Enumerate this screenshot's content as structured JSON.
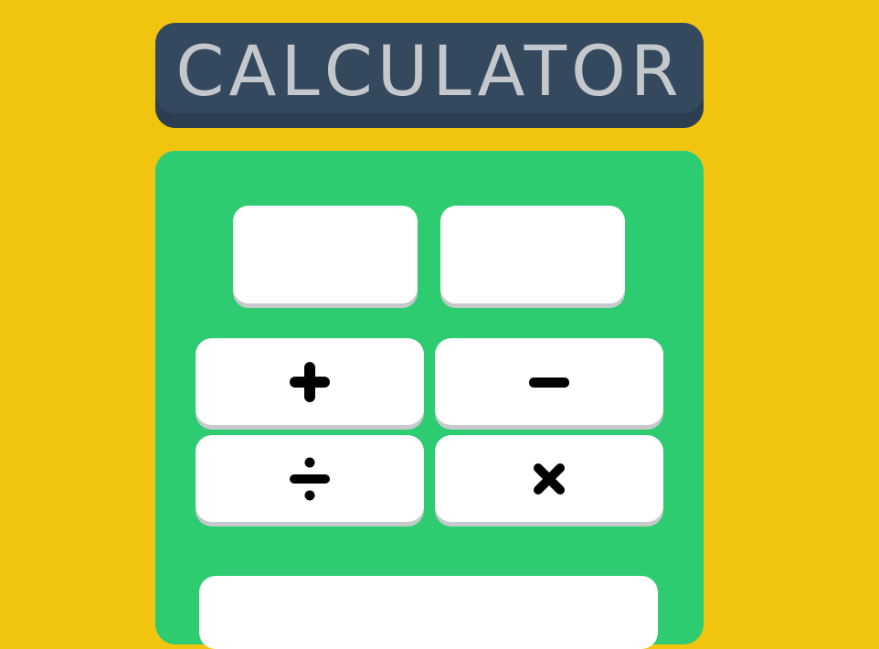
{
  "header": {
    "title": "CALCULATOR"
  },
  "inputs": {
    "first_value": "",
    "second_value": ""
  },
  "operators": [
    {
      "name": "add",
      "icon": "plus-icon"
    },
    {
      "name": "subtract",
      "icon": "minus-icon"
    },
    {
      "name": "divide",
      "icon": "divide-icon"
    },
    {
      "name": "multiply",
      "icon": "multiply-icon"
    }
  ],
  "result": {
    "value": ""
  },
  "colors": {
    "background": "#f1c40f",
    "title_bar": "#34495e",
    "title_text": "#c4c8cc",
    "panel": "#2ecc71",
    "button": "#ffffff",
    "button_shadow": "#c7c9cd",
    "icon": "#000000"
  }
}
